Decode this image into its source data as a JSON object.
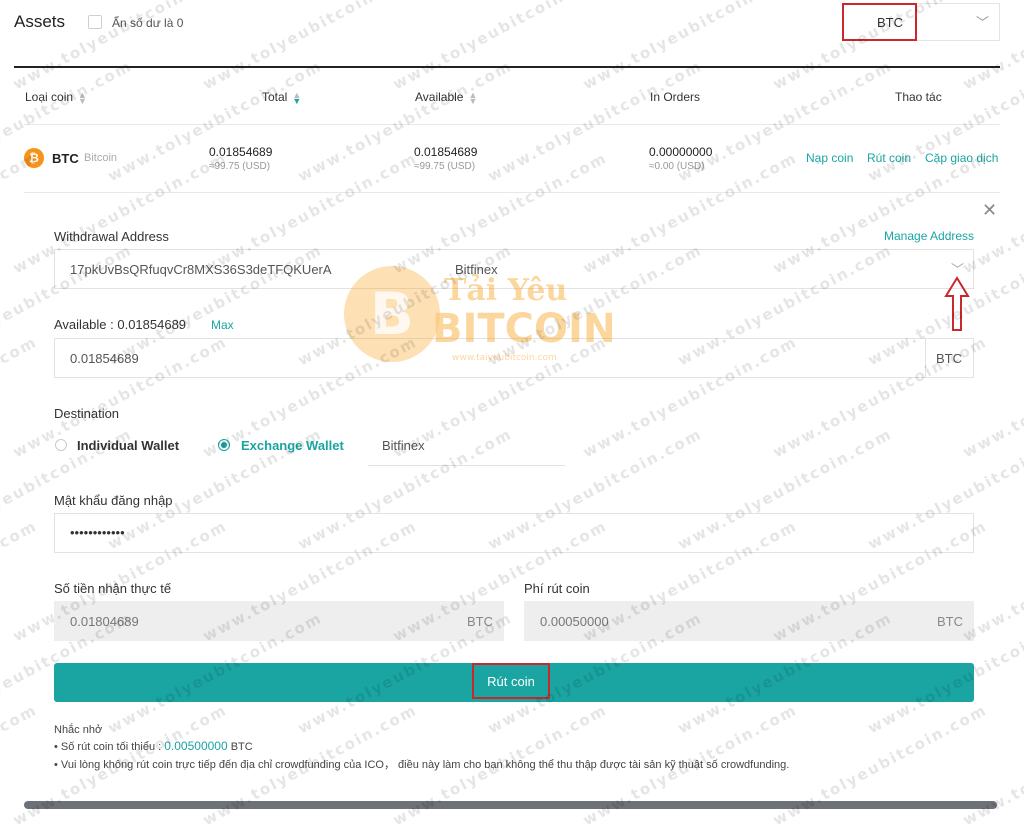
{
  "header": {
    "title": "Assets",
    "hide_zero_label": "Ẩn số dư là 0",
    "coin_select_value": "BTC"
  },
  "table": {
    "columns": [
      "Loại coin",
      "Total",
      "Available",
      "In Orders",
      "Thao tác"
    ],
    "row": {
      "symbol": "BTC",
      "name": "Bitcoin",
      "total": "0.01854689",
      "total_usd": "≈99.75 (USD)",
      "available": "0.01854689",
      "available_usd": "≈99.75 (USD)",
      "in_orders": "0.00000000",
      "in_orders_usd": "≈0.00 (USD)",
      "actions": [
        "Nạp coin",
        "Rút coin",
        "Cặp giao dịch"
      ]
    }
  },
  "withdraw": {
    "address_label": "Withdrawal Address",
    "manage_address": "Manage Address",
    "address_value": "17pkUvBsQRfuqvCr8MXS36S3deTFQKUerA",
    "address_tag": "Bitfinex",
    "available_label": "Available : 0.01854689",
    "max_label": "Max",
    "amount_value": "0.01854689",
    "amount_unit": "BTC",
    "destination_label": "Destination",
    "dest_individual": "Individual Wallet",
    "dest_exchange": "Exchange Wallet",
    "dest_exchange_name": "Bitfinex",
    "password_label": "Mật khẩu đăng nhập",
    "password_value": "••••••••••••",
    "received_label": "Số tiền nhận thực tế",
    "received_value": "0.01804689",
    "received_unit": "BTC",
    "fee_label": "Phí rút coin",
    "fee_value": "0.00050000",
    "fee_unit": "BTC",
    "submit_label": "Rút coin",
    "note_title": "Nhắc nhở",
    "note_min_prefix": "• Số rút coin tối thiểu :",
    "note_min_value": "0.00500000",
    "note_min_unit": "BTC",
    "note_warning": "• Vui lòng không rút coin trực tiếp đến địa chỉ crowdfunding của ICO， điều này làm cho bạn không thể thu thập được tài sản kỹ thuật số crowdfunding."
  },
  "icons": {
    "coin": "bitcoin-icon",
    "close": "close-icon",
    "dropdown": "chevron-down-icon",
    "annotation": "red-up-arrow-icon"
  },
  "colors": {
    "accent": "#1aa5a3",
    "highlight": "#c9282d",
    "bitcoin": "#f7931a"
  },
  "watermark": {
    "text": "www.tolyeubitcoin.com",
    "logo_top": "Tải Yêu",
    "logo_main": "BITCOIN",
    "logo_url": "www.taiyeubitcoin.com"
  }
}
